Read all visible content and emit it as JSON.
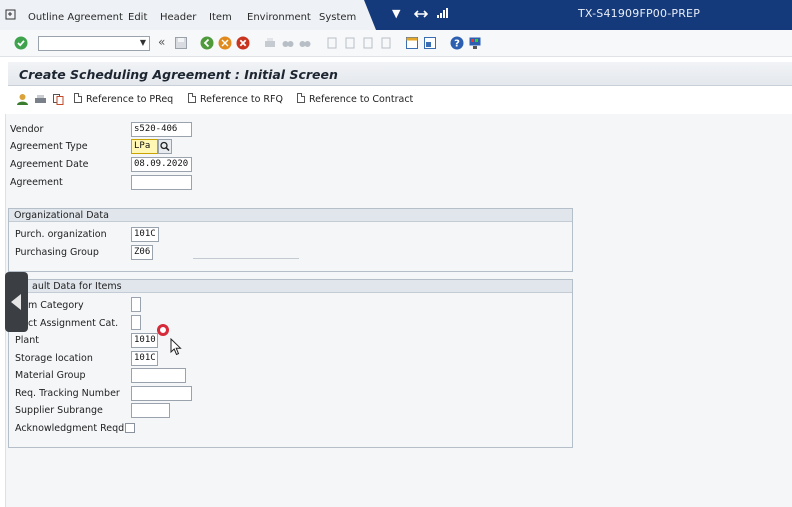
{
  "menubar": {
    "items": [
      "Outline Agreement",
      "Edit",
      "Header",
      "Item",
      "Environment",
      "System"
    ],
    "system_title": "TX-S41909FP00-PREP"
  },
  "toolbar": {
    "command_field": {
      "value": "",
      "placeholder": ""
    },
    "icons": [
      "enter-icon",
      "back-icon",
      "save-icon",
      "exit-icon",
      "cancel-icon",
      "print-icon",
      "find-icon",
      "find-next-icon",
      "first-page-icon",
      "prev-page-icon",
      "next-page-icon",
      "last-page-icon",
      "create-session-icon",
      "shortcut-icon",
      "help-icon",
      "customize-layout-icon"
    ]
  },
  "screen": {
    "title": "Create Scheduling Agreement : Initial Screen"
  },
  "app_toolbar": {
    "reference_preq": "Reference to PReq",
    "reference_rfq": "Reference to RFQ",
    "reference_contract": "Reference to Contract"
  },
  "header_fields": {
    "vendor_label": "Vendor",
    "vendor_value": "s520-406",
    "agreement_type_label": "Agreement Type",
    "agreement_type_value": "LPa",
    "agreement_date_label": "Agreement Date",
    "agreement_date_value": "08.09.2020",
    "agreement_label": "Agreement",
    "agreement_value": ""
  },
  "org_data": {
    "title": "Organizational Data",
    "purch_org_label": "Purch. organization",
    "purch_org_value": "101C",
    "purch_group_label": "Purchasing Group",
    "purch_group_value": "Z06"
  },
  "default_data": {
    "title": "ault Data for Items",
    "item_category_label": "m Category",
    "acct_assignment_label": "ct Assignment Cat.",
    "plant_label": "Plant",
    "plant_value": "1010",
    "storage_location_label": "Storage location",
    "storage_location_value": "101C",
    "material_group_label": "Material Group",
    "req_tracking_label": "Req. Tracking Number",
    "supplier_subrange_label": "Supplier Subrange",
    "acknowledgment_label": "Acknowledgment Reqd"
  },
  "colors": {
    "title_bar": "#153a7b",
    "required_field": "#fff7b3",
    "click_marker": "#d62b3a"
  }
}
